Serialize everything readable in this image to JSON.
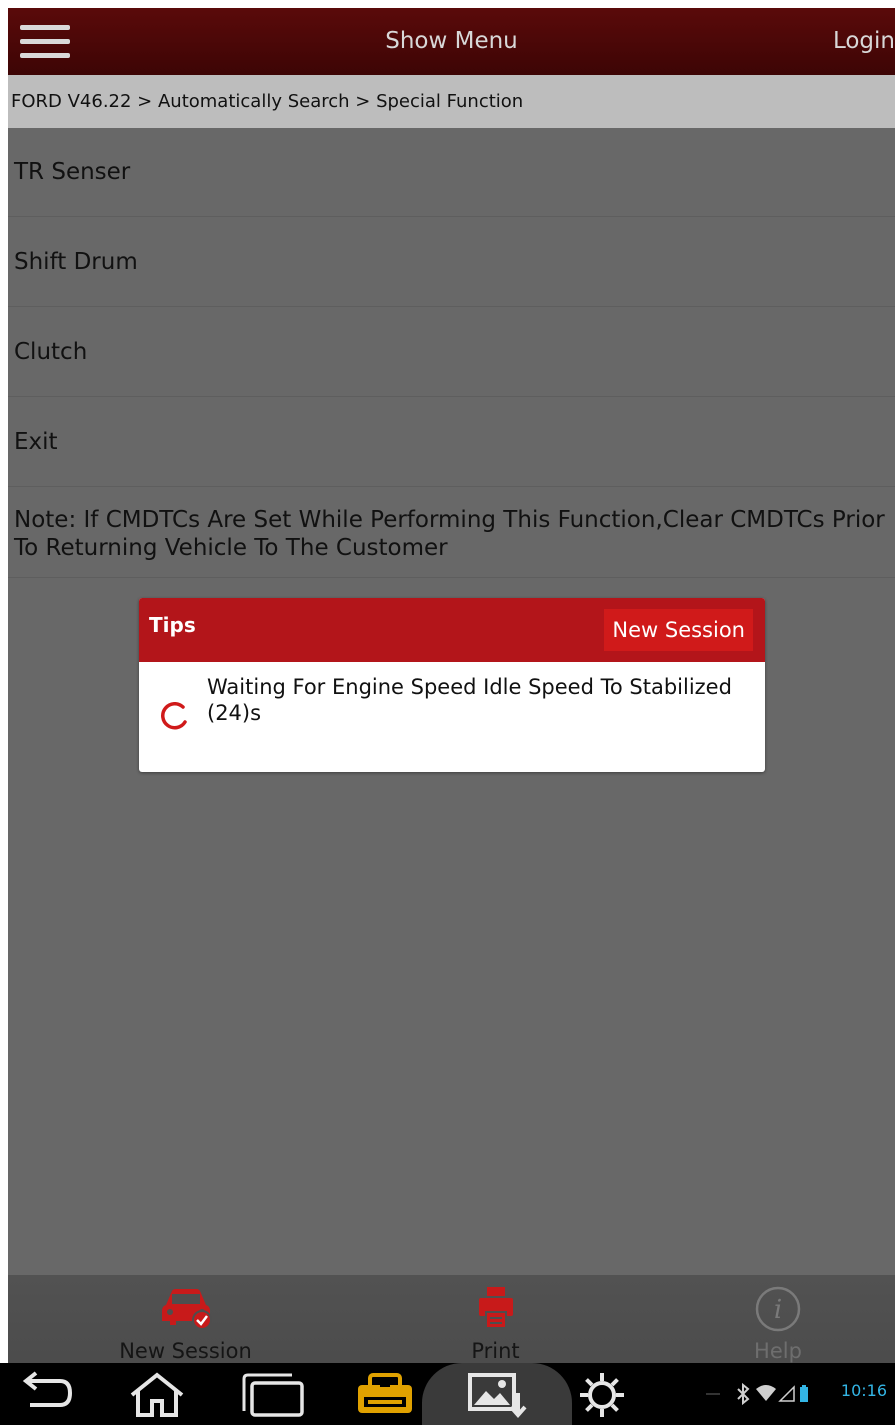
{
  "topbar": {
    "title": "Show Menu",
    "login": "Login",
    "menu_icon": "hamburger-icon"
  },
  "breadcrumb": "FORD V46.22 > Automatically Search > Special Function",
  "menu_items": [
    {
      "label": "TR Senser"
    },
    {
      "label": "Shift Drum"
    },
    {
      "label": "Clutch"
    },
    {
      "label": "Exit"
    }
  ],
  "note": "Note: If CMDTCs Are Set While Performing This Function,Clear CMDTCs Prior To Returning Vehicle To The Customer",
  "dialog": {
    "title": "Tips",
    "button": "New Session",
    "message_line1": "Waiting For Engine Speed Idle Speed To Stabilized",
    "message_line2": "(24)s",
    "spinner_icon": "loading-spinner-icon"
  },
  "bottombar": {
    "items": [
      {
        "label": "New Session",
        "icon": "car-check-icon"
      },
      {
        "label": "Print",
        "icon": "printer-icon"
      },
      {
        "label": "Help",
        "icon": "info-icon"
      }
    ]
  },
  "system_bar": {
    "time": "10:16",
    "icons": [
      "back-icon",
      "home-icon",
      "recent-apps-icon",
      "maximus-app-icon",
      "screenshot-icon",
      "settings-icon"
    ],
    "status_icons": [
      "bluetooth-icon",
      "wifi-icon",
      "signal-icon",
      "battery-icon"
    ]
  },
  "colors": {
    "topbar": "#4a0707",
    "dialog_header": "#b3151a",
    "accent_red": "#d01a1a",
    "overlay_gray": "#686868",
    "time_blue": "#33b5e5"
  }
}
